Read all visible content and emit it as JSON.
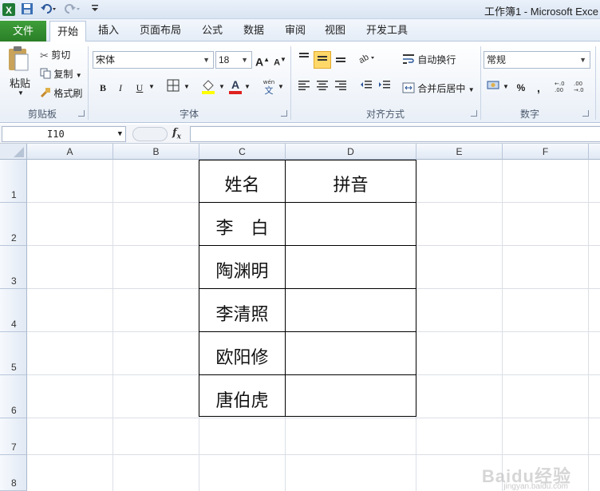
{
  "window": {
    "title": "工作簿1 - Microsoft Exce"
  },
  "quick_access": [
    "save-icon",
    "undo-icon",
    "redo-icon",
    "customize-icon"
  ],
  "tabs": [
    {
      "label": "文件"
    },
    {
      "label": "开始"
    },
    {
      "label": "插入"
    },
    {
      "label": "页面布局"
    },
    {
      "label": "公式"
    },
    {
      "label": "数据"
    },
    {
      "label": "审阅"
    },
    {
      "label": "视图"
    },
    {
      "label": "开发工具"
    }
  ],
  "clipboard": {
    "paste": "粘贴",
    "cut": "剪切",
    "copy": "复制",
    "format_painter": "格式刷",
    "label": "剪贴板"
  },
  "font": {
    "name": "宋体",
    "size": "18",
    "bold": "B",
    "italic": "I",
    "underline": "U",
    "label": "字体"
  },
  "alignment": {
    "wrap": "自动换行",
    "merge": "合并后居中",
    "label": "对齐方式"
  },
  "number": {
    "format": "常规",
    "percent": "%",
    "comma": ",",
    "label": "数字"
  },
  "formula_bar": {
    "name_box": "I10",
    "fx": "fx",
    "content": ""
  },
  "columns": [
    "A",
    "B",
    "C",
    "D",
    "E",
    "F"
  ],
  "rows": [
    "1",
    "2",
    "3",
    "4",
    "5",
    "6",
    "7",
    "8"
  ],
  "table": {
    "header": {
      "name": "姓名",
      "pinyin": "拼音"
    },
    "names": [
      "李　白",
      "陶渊明",
      "李清照",
      "欧阳修",
      "唐伯虎"
    ]
  },
  "colors": {
    "file_tab": "#2a7f27",
    "active_button": "#ffd86a",
    "header_bg": "#e1e9f4"
  },
  "watermark": {
    "text": "Baidu经验",
    "sub": "jingyan.baidu.com"
  }
}
